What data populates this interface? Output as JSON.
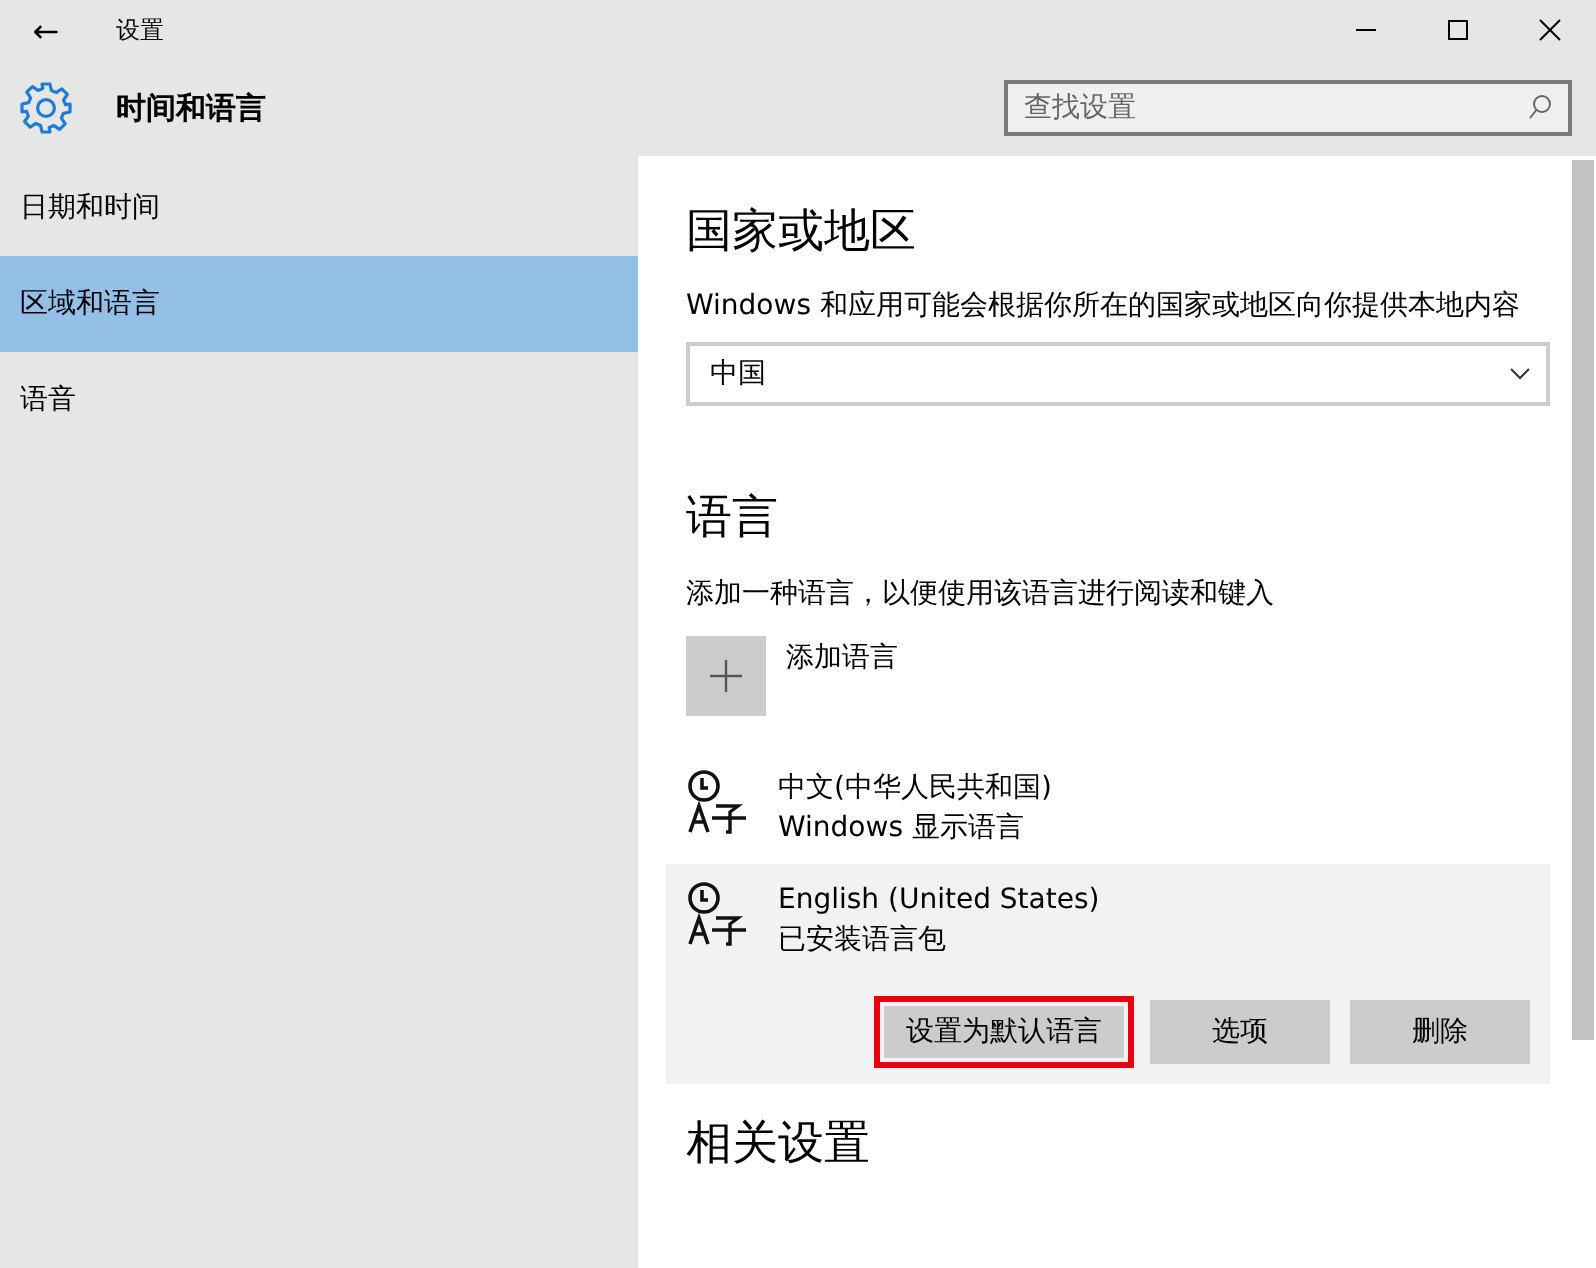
{
  "window": {
    "title": "设置",
    "back": "←"
  },
  "header": {
    "title": "时间和语言"
  },
  "search": {
    "placeholder": "查找设置"
  },
  "sidebar": {
    "items": [
      {
        "label": "日期和时间",
        "selected": false
      },
      {
        "label": "区域和语言",
        "selected": true
      },
      {
        "label": "语音",
        "selected": false
      }
    ]
  },
  "region": {
    "heading": "国家或地区",
    "description": "Windows 和应用可能会根据你所在的国家或地区向你提供本地内容",
    "value": "中国"
  },
  "language": {
    "heading": "语言",
    "description": "添加一种语言，以便使用该语言进行阅读和键入",
    "add_label": "添加语言",
    "items": [
      {
        "name": "中文(中华人民共和国)",
        "status": "Windows 显示语言",
        "selected": false
      },
      {
        "name": "English (United States)",
        "status": "已安装语言包",
        "selected": true
      }
    ],
    "buttons": [
      {
        "label": "设置为默认语言",
        "highlighted": true
      },
      {
        "label": "选项",
        "highlighted": false
      },
      {
        "label": "删除",
        "highlighted": false
      }
    ]
  },
  "related": {
    "heading": "相关设置"
  }
}
